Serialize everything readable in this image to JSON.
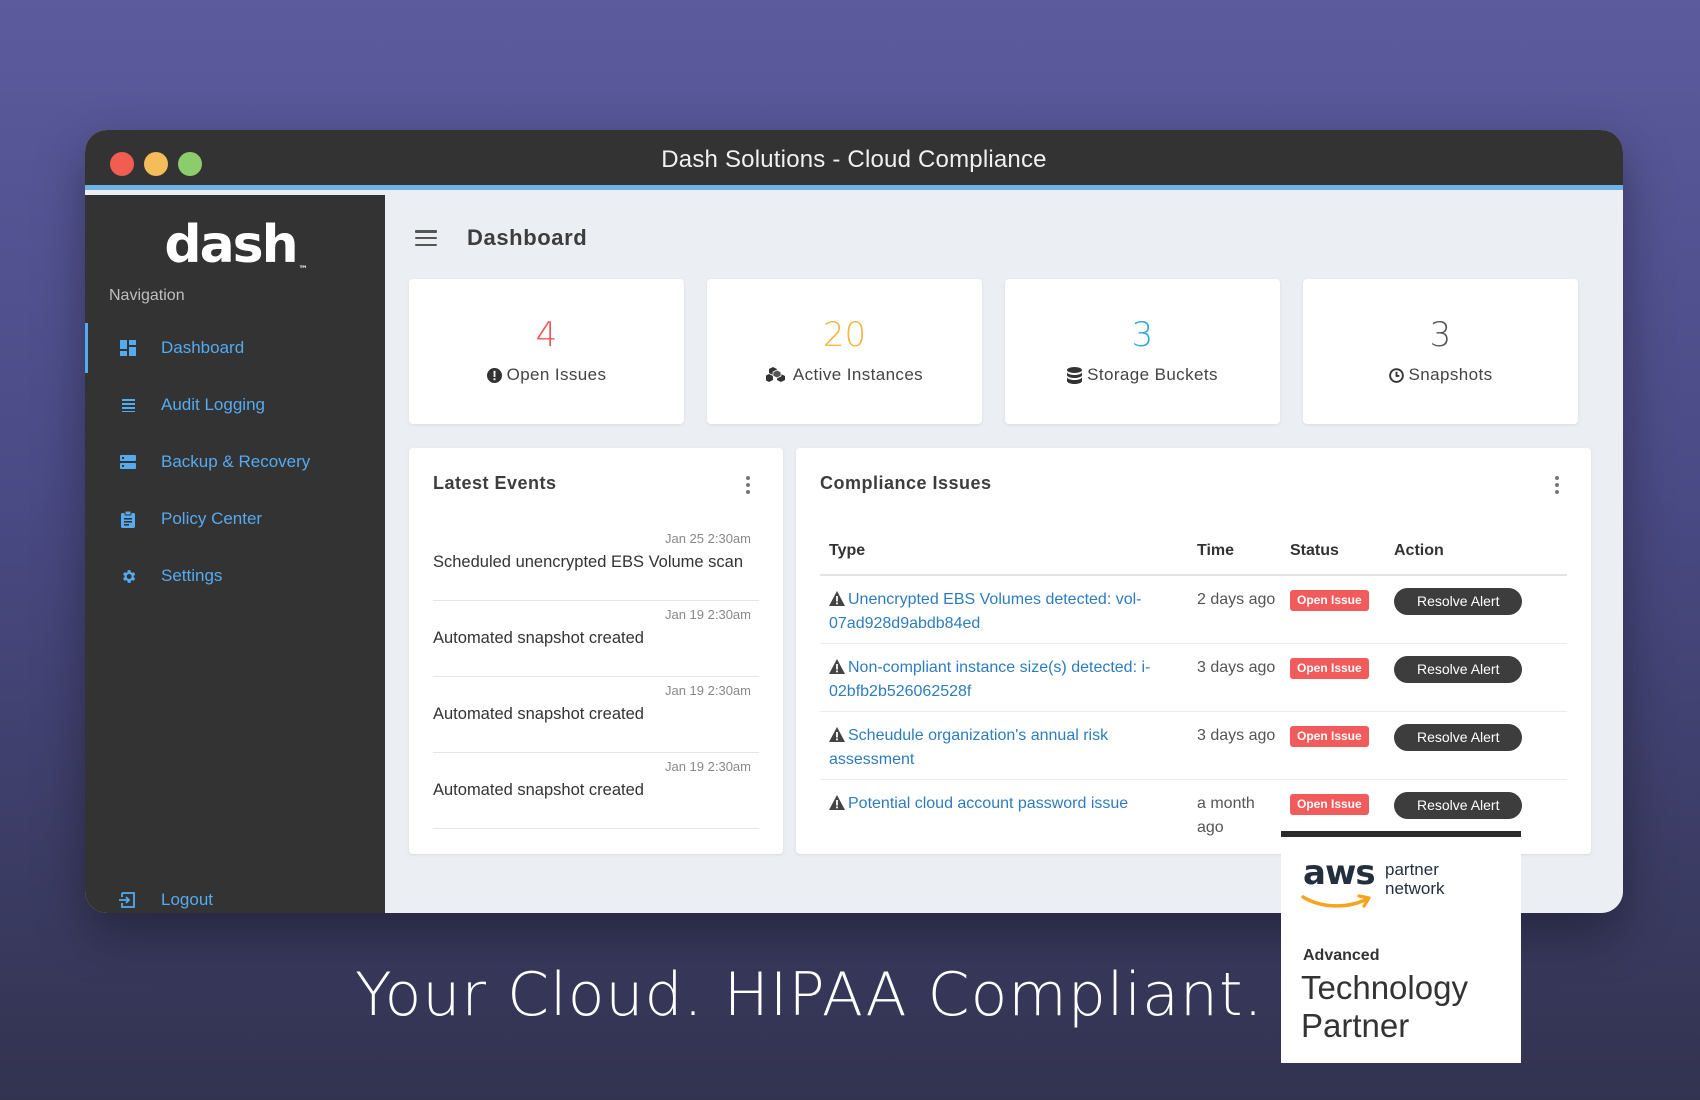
{
  "window": {
    "title": "Dash Solutions - Cloud Compliance"
  },
  "sidebar": {
    "logo": "dash",
    "logo_mark": "™",
    "heading": "Navigation",
    "items": [
      {
        "label": "Dashboard",
        "icon": "dashboard-icon",
        "active": true
      },
      {
        "label": "Audit Logging",
        "icon": "list-icon",
        "active": false
      },
      {
        "label": "Backup & Recovery",
        "icon": "server-icon",
        "active": false
      },
      {
        "label": "Policy Center",
        "icon": "clipboard-icon",
        "active": false
      },
      {
        "label": "Settings",
        "icon": "gear-icon",
        "active": false
      }
    ],
    "logout": {
      "label": "Logout",
      "icon": "logout-icon"
    }
  },
  "header": {
    "title": "Dashboard"
  },
  "stats": [
    {
      "value": "4",
      "label": "Open Issues",
      "color": "#f05454",
      "icon": "alert-circle-icon"
    },
    {
      "value": "20",
      "label": "Active Instances",
      "color": "#f4b63f",
      "icon": "cubes-icon"
    },
    {
      "value": "3",
      "label": "Storage Buckets",
      "color": "#2fa7de",
      "icon": "database-icon"
    },
    {
      "value": "3",
      "label": "Snapshots",
      "color": "#555555",
      "icon": "clock-icon"
    }
  ],
  "events": {
    "title": "Latest Events",
    "items": [
      {
        "time": "Jan 25 2:30am",
        "text": "Scheduled unencrypted EBS Volume scan"
      },
      {
        "time": "Jan 19 2:30am",
        "text": "Automated snapshot created"
      },
      {
        "time": "Jan 19 2:30am",
        "text": "Automated snapshot created"
      },
      {
        "time": "Jan 19 2:30am",
        "text": "Automated snapshot created"
      }
    ]
  },
  "compliance": {
    "title": "Compliance Issues",
    "columns": {
      "type": "Type",
      "time": "Time",
      "status": "Status",
      "action": "Action"
    },
    "rows": [
      {
        "type": "Unencrypted EBS Volumes detected: vol-07ad928d9abdb84ed",
        "time": "2 days ago",
        "status": "Open Issue",
        "action": "Resolve Alert"
      },
      {
        "type": "Non-compliant instance size(s) detected: i-02bfb2b526062528f",
        "time": "3 days ago",
        "status": "Open Issue",
        "action": "Resolve Alert"
      },
      {
        "type": "Scheudule organization's annual risk assessment",
        "time": "3 days ago",
        "status": "Open Issue",
        "action": "Resolve Alert"
      },
      {
        "type": "Potential cloud account password issue",
        "time": "a month ago",
        "status": "Open Issue",
        "action": "Resolve Alert"
      }
    ]
  },
  "footer": {
    "tagline": "Your Cloud. HIPAA Compliant.",
    "badge": {
      "brand": "aws",
      "network_line1": "partner",
      "network_line2": "network",
      "tier": "Advanced",
      "title_line1": "Technology",
      "title_line2": "Partner"
    }
  },
  "colors": {
    "accent": "#55aaf0",
    "danger": "#f25b5b",
    "link": "#2e7cc0",
    "sidebar_bg": "#333333"
  }
}
